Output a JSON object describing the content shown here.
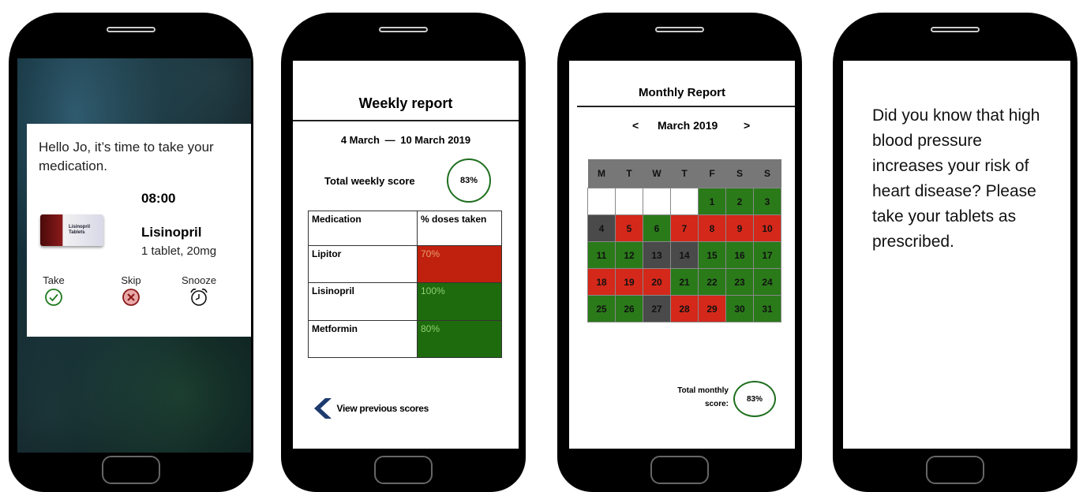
{
  "reminder": {
    "greeting": "Hello Jo, it’s time to take your medication.",
    "time": "08:00",
    "box_label": "Lisinopril Tablets",
    "med_name": "Lisinopril",
    "dose": "1 tablet, 20mg",
    "actions": [
      {
        "label": "Take",
        "icon": "check-circle-icon",
        "color": "#1f7a1f"
      },
      {
        "label": "Skip",
        "icon": "x-circle-icon",
        "color": "#8b1a1a"
      },
      {
        "label": "Snooze",
        "icon": "alarm-clock-icon",
        "color": "#111111"
      }
    ]
  },
  "weekly": {
    "title": "Weekly report",
    "range_start": "4 March",
    "range_sep": "—",
    "range_end": "10 March 2019",
    "score_label": "Total weekly score",
    "score": "83%",
    "table_headers": [
      "Medication",
      "% doses taken"
    ],
    "rows": [
      {
        "medication": "Lipitor",
        "percent": "70%",
        "color": "#c0200e"
      },
      {
        "medication": "Lisinopril",
        "percent": "100%",
        "color": "#1e6b0e"
      },
      {
        "medication": "Metformin",
        "percent": "80%",
        "color": "#1e6b0e"
      }
    ],
    "prev_link": "View previous scores"
  },
  "monthly": {
    "title": "Monthly Report",
    "prev": "<",
    "month": "March 2019",
    "next": ">",
    "weekdays": [
      "M",
      "T",
      "W",
      "T",
      "F",
      "S",
      "S"
    ],
    "leading_blanks": 4,
    "days": [
      {
        "d": "1",
        "s": "green"
      },
      {
        "d": "2",
        "s": "green"
      },
      {
        "d": "3",
        "s": "green"
      },
      {
        "d": "4",
        "s": "grey"
      },
      {
        "d": "5",
        "s": "red"
      },
      {
        "d": "6",
        "s": "green"
      },
      {
        "d": "7",
        "s": "red"
      },
      {
        "d": "8",
        "s": "red"
      },
      {
        "d": "9",
        "s": "red"
      },
      {
        "d": "10",
        "s": "red"
      },
      {
        "d": "11",
        "s": "green"
      },
      {
        "d": "12",
        "s": "green"
      },
      {
        "d": "13",
        "s": "grey"
      },
      {
        "d": "14",
        "s": "grey"
      },
      {
        "d": "15",
        "s": "green"
      },
      {
        "d": "16",
        "s": "green"
      },
      {
        "d": "17",
        "s": "green"
      },
      {
        "d": "18",
        "s": "red"
      },
      {
        "d": "19",
        "s": "red"
      },
      {
        "d": "20",
        "s": "red"
      },
      {
        "d": "21",
        "s": "green"
      },
      {
        "d": "22",
        "s": "green"
      },
      {
        "d": "23",
        "s": "green"
      },
      {
        "d": "24",
        "s": "green"
      },
      {
        "d": "25",
        "s": "green"
      },
      {
        "d": "26",
        "s": "green"
      },
      {
        "d": "27",
        "s": "grey"
      },
      {
        "d": "28",
        "s": "red"
      },
      {
        "d": "29",
        "s": "red"
      },
      {
        "d": "30",
        "s": "green"
      },
      {
        "d": "31",
        "s": "green"
      }
    ],
    "colors": {
      "green": "#2a7a1a",
      "red": "#d4281a",
      "grey": "#4a4a4a",
      "header": "#777777"
    },
    "score_label_1": "Total monthly",
    "score_label_2": "score:",
    "score": "83%"
  },
  "fact": {
    "text": "Did you know that high blood pressure increases your risk of heart disease? Please take your tablets as prescribed."
  }
}
